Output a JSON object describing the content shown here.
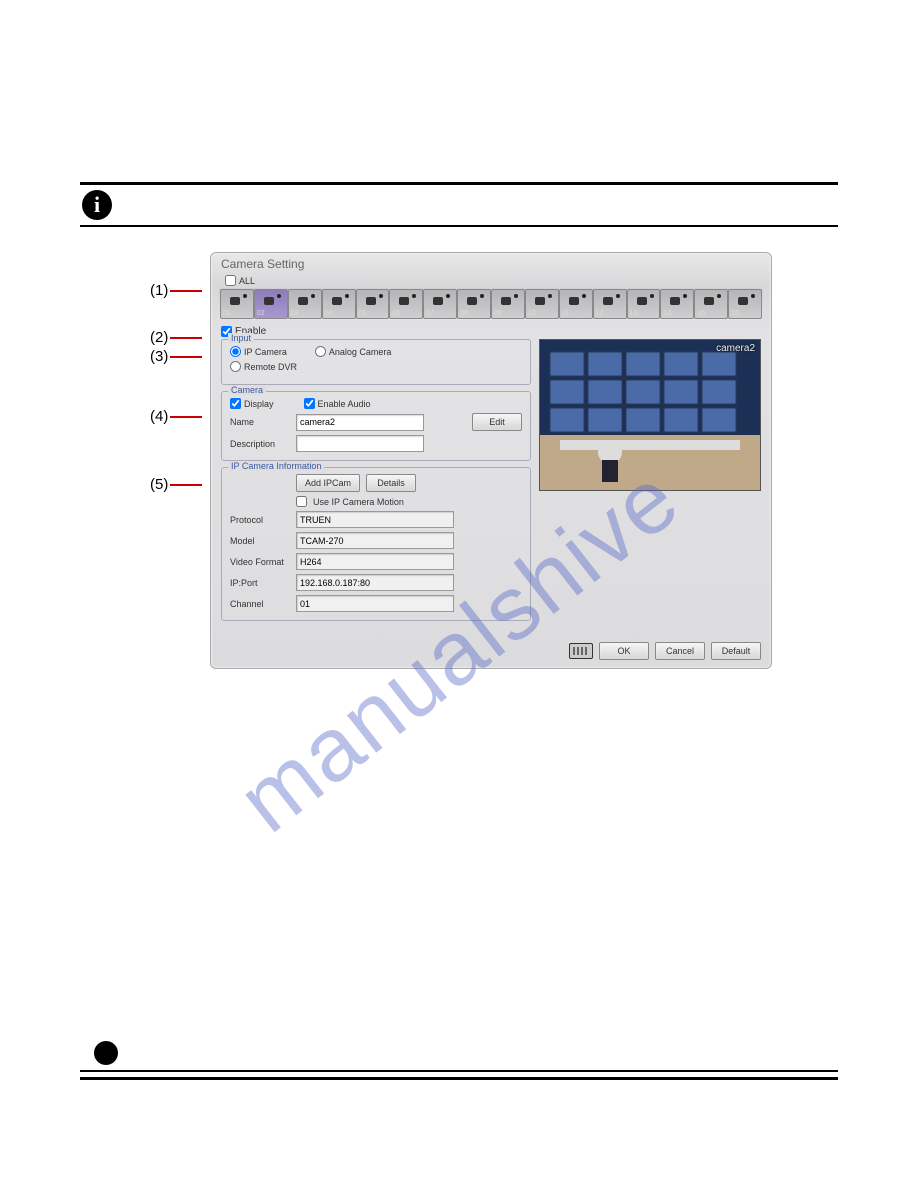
{
  "watermark": "manualshive",
  "dialog": {
    "title": "Camera Setting",
    "all_label": "ALL",
    "enable_label": "Enable",
    "enable_checked": true,
    "cameras": [
      "01",
      "02",
      "03",
      "04",
      "05",
      "06",
      "07",
      "08",
      "09",
      "10",
      "11",
      "12",
      "13",
      "14",
      "15",
      "16"
    ],
    "selected_camera_index": 1
  },
  "input": {
    "legend": "Input",
    "opt_ipcam": "IP Camera",
    "opt_analog": "Analog Camera",
    "opt_remote": "Remote DVR",
    "selected": "ipcam"
  },
  "camera": {
    "legend": "Camera",
    "display_label": "Display",
    "display_checked": true,
    "audio_label": "Enable Audio",
    "audio_checked": true,
    "name_label": "Name",
    "name_value": "camera2",
    "desc_label": "Description",
    "desc_value": "",
    "edit_btn": "Edit"
  },
  "ipcam": {
    "legend": "IP Camera Information",
    "add_btn": "Add IPCam",
    "details_btn": "Details",
    "motion_label": "Use IP Camera Motion",
    "motion_checked": false,
    "rows": {
      "protocol_label": "Protocol",
      "protocol_value": "TRUEN",
      "model_label": "Model",
      "model_value": "TCAM-270",
      "format_label": "Video Format",
      "format_value": "H264",
      "ipport_label": "IP:Port",
      "ipport_value": "192.168.0.187:80",
      "channel_label": "Channel",
      "channel_value": "01"
    }
  },
  "preview_label": "camera2",
  "buttons": {
    "ok": "OK",
    "cancel": "Cancel",
    "default": "Default"
  },
  "callouts": [
    "(1)",
    "(2)",
    "(3)",
    "(4)",
    "(5)"
  ]
}
